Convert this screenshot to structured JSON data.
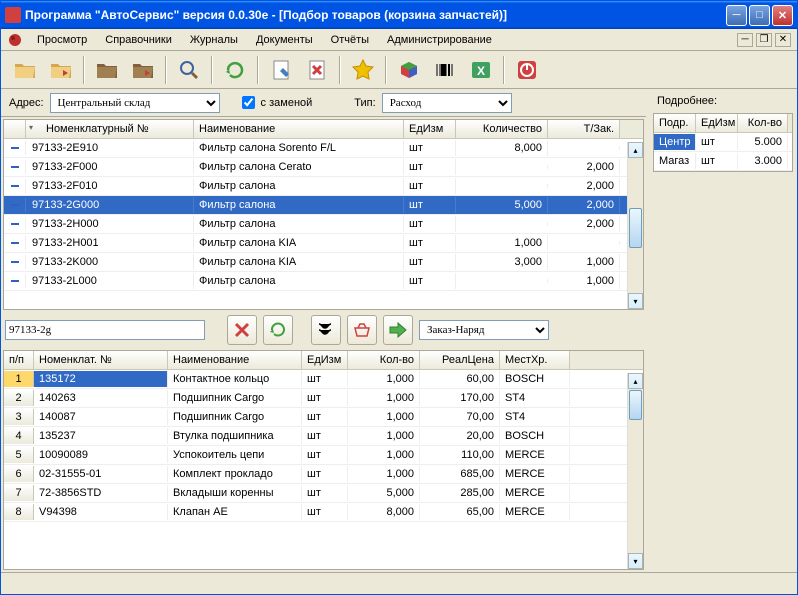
{
  "window": {
    "title": "Программа \"АвтоСервис\" версия 0.0.30e - [Подбор товаров (корзина запчастей)]"
  },
  "menu": [
    "Просмотр",
    "Справочники",
    "Журналы",
    "Документы",
    "Отчёты",
    "Администрирование"
  ],
  "filter": {
    "address_label": "Адрес:",
    "address_value": "Центральный склад",
    "with_replace_label": "с заменой",
    "type_label": "Тип:",
    "type_value": "Расход"
  },
  "top_grid": {
    "headers": [
      "",
      "Номенклатурный №",
      "Наименование",
      "ЕдИзм",
      "Количество",
      "Т/Зак."
    ],
    "rows": [
      {
        "num": "97133-2E910",
        "name": "Фильтр салона Sorento F/L",
        "unit": "шт",
        "qty": "8,000",
        "tz": ""
      },
      {
        "num": "97133-2F000",
        "name": "Фильтр салона Cerato",
        "unit": "шт",
        "qty": "",
        "tz": "2,000"
      },
      {
        "num": "97133-2F010",
        "name": "Фильтр салона",
        "unit": "шт",
        "qty": "",
        "tz": "2,000"
      },
      {
        "num": "97133-2G000",
        "name": "Фильтр салона",
        "unit": "шт",
        "qty": "5,000",
        "tz": "2,000",
        "sel": true
      },
      {
        "num": "97133-2H000",
        "name": "Фильтр салона",
        "unit": "шт",
        "qty": "",
        "tz": "2,000"
      },
      {
        "num": "97133-2H001",
        "name": "Фильтр салона KIA",
        "unit": "шт",
        "qty": "1,000",
        "tz": ""
      },
      {
        "num": "97133-2K000",
        "name": "Фильтр салона KIA",
        "unit": "шт",
        "qty": "3,000",
        "tz": "1,000"
      },
      {
        "num": "97133-2L000",
        "name": "Фильтр салона",
        "unit": "шт",
        "qty": "",
        "tz": "1,000"
      }
    ]
  },
  "search_value": "97133-2g",
  "order_select": "Заказ-Наряд",
  "bottom_grid": {
    "headers": [
      "п/п",
      "Номенклат. №",
      "Наименование",
      "ЕдИзм",
      "Кол-во",
      "РеалЦена",
      "МестХр."
    ],
    "rows": [
      {
        "n": "1",
        "num": "135172",
        "name": "Контактное кольцо",
        "unit": "шт",
        "qty": "1,000",
        "price": "60,00",
        "loc": "BOSCH",
        "sel": true
      },
      {
        "n": "2",
        "num": "140263",
        "name": "Подшипник Cargo",
        "unit": "шт",
        "qty": "1,000",
        "price": "170,00",
        "loc": "ST4"
      },
      {
        "n": "3",
        "num": "140087",
        "name": "Подшипник Cargo",
        "unit": "шт",
        "qty": "1,000",
        "price": "70,00",
        "loc": "ST4"
      },
      {
        "n": "4",
        "num": "135237",
        "name": "Втулка подшипника",
        "unit": "шт",
        "qty": "1,000",
        "price": "20,00",
        "loc": "BOSCH"
      },
      {
        "n": "5",
        "num": "10090089",
        "name": "Успокоитель цепи",
        "unit": "шт",
        "qty": "1,000",
        "price": "110,00",
        "loc": "MERCE"
      },
      {
        "n": "6",
        "num": "02-31555-01",
        "name": "Комплект прокладо",
        "unit": "шт",
        "qty": "1,000",
        "price": "685,00",
        "loc": "MERCE"
      },
      {
        "n": "7",
        "num": "72-3856STD",
        "name": "Вкладыши коренны",
        "unit": "шт",
        "qty": "5,000",
        "price": "285,00",
        "loc": "MERCE"
      },
      {
        "n": "8",
        "num": "V94398",
        "name": "Клапан AE",
        "unit": "шт",
        "qty": "8,000",
        "price": "65,00",
        "loc": "MERCE"
      }
    ]
  },
  "side": {
    "title": "Подробнее:",
    "headers": [
      "Подр.",
      "ЕдИзм",
      "Кол-во"
    ],
    "rows": [
      {
        "dept": "Центр",
        "unit": "шт",
        "qty": "5.000",
        "sel": true
      },
      {
        "dept": "Магаз",
        "unit": "шт",
        "qty": "3.000"
      }
    ]
  }
}
